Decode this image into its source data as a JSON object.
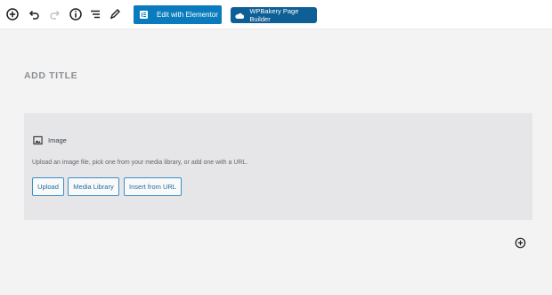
{
  "toolbar": {
    "icons": [
      "add-block-icon",
      "undo-icon",
      "redo-icon",
      "info-icon",
      "block-navigation-icon",
      "edit-pencil-icon"
    ],
    "elementor_label": "Edit with Elementor",
    "wpbakery_label": "WPBakery Page Builder"
  },
  "editor": {
    "title_placeholder": "ADD TITLE",
    "image_block": {
      "icon": "image-icon",
      "label": "Image",
      "instructions": "Upload an image file, pick one from your media library, or add one with a URL.",
      "buttons": {
        "upload": "Upload",
        "media_library": "Media Library",
        "insert_url": "Insert from URL"
      }
    },
    "add_block_icon": "plus-circle-icon"
  },
  "colors": {
    "elementor_blue": "#0a7bbd",
    "wpbakery_blue": "#0e5f95",
    "button_border": "#3c8fc9",
    "canvas_bg": "#f3f3f3",
    "block_bg": "#e6e6e8"
  }
}
